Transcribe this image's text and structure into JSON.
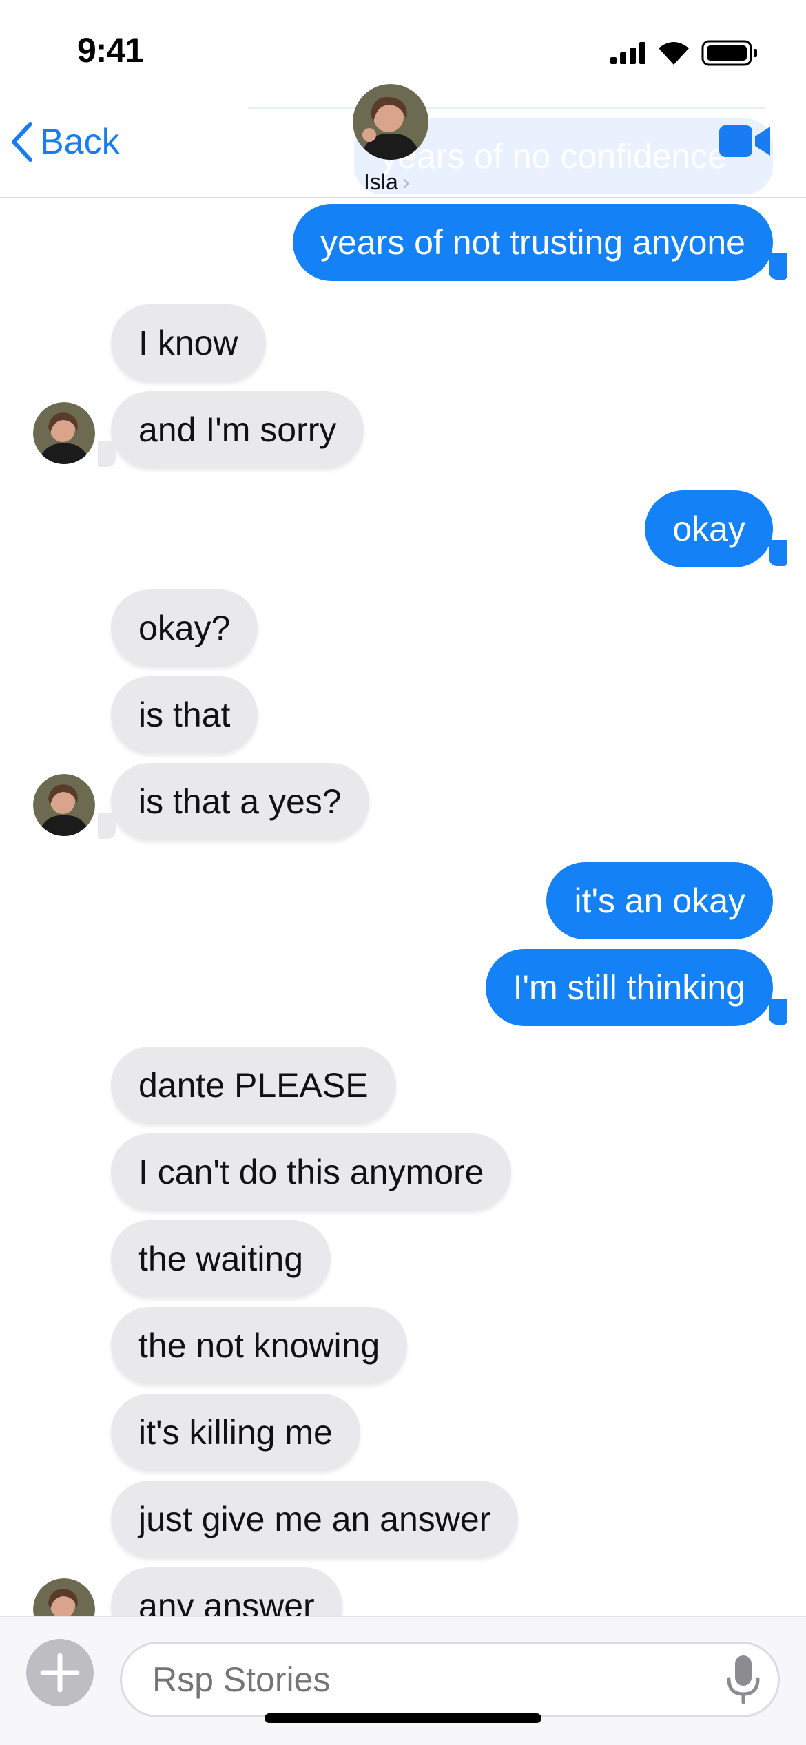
{
  "status_bar": {
    "time": "9:41"
  },
  "header": {
    "back_label": "Back",
    "contact_name": "Isla",
    "peek_text": "years of no confidence"
  },
  "messages": [
    {
      "side": "out",
      "text": "years of not trusting anyone"
    },
    {
      "side": "in",
      "text": "I know"
    },
    {
      "side": "in",
      "text": "and I'm sorry"
    },
    {
      "side": "out",
      "text": "okay"
    },
    {
      "side": "in",
      "text": "okay?"
    },
    {
      "side": "in",
      "text": "is that"
    },
    {
      "side": "in",
      "text": "is that a yes?"
    },
    {
      "side": "out",
      "text": "it's an okay"
    },
    {
      "side": "out",
      "text": "I'm still thinking"
    },
    {
      "side": "in",
      "text": "dante PLEASE"
    },
    {
      "side": "in",
      "text": "I can't do this anymore"
    },
    {
      "side": "in",
      "text": "the waiting"
    },
    {
      "side": "in",
      "text": "the not knowing"
    },
    {
      "side": "in",
      "text": "it's killing me"
    },
    {
      "side": "in",
      "text": "just give me an answer"
    },
    {
      "side": "in",
      "text": "any answer"
    }
  ],
  "composer": {
    "placeholder": "Rsp Stories"
  },
  "colors": {
    "accent": "#1482f6",
    "incoming_bubble": "#e9e9eb",
    "link": "#1a7cf2"
  }
}
